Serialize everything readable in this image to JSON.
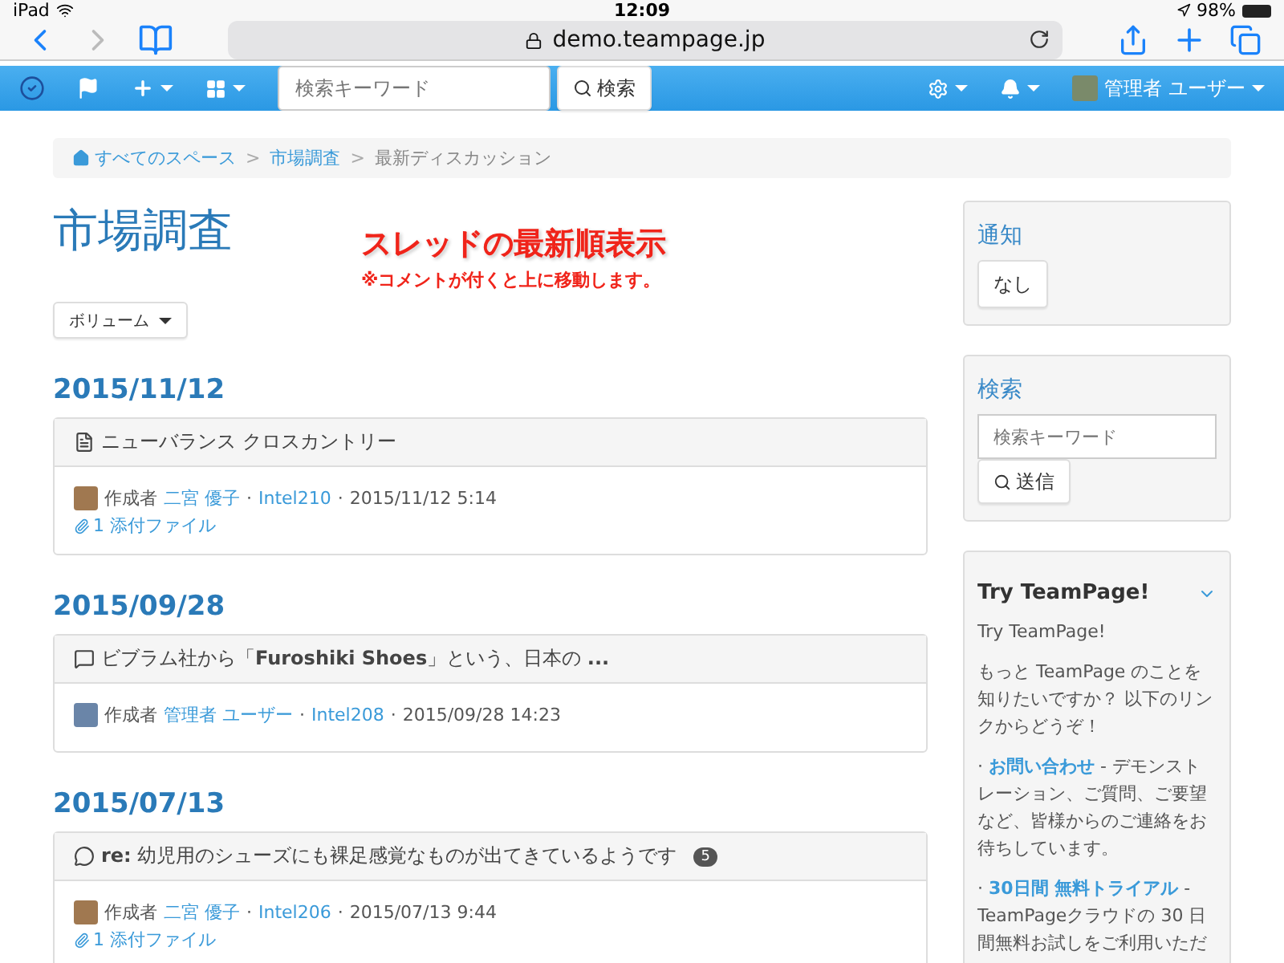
{
  "status_bar": {
    "device": "iPad",
    "time": "12:09",
    "battery": "98%"
  },
  "browser": {
    "url": "demo.teampage.jp"
  },
  "navbar": {
    "search_placeholder": "検索キーワード",
    "search_button": "検索",
    "user": "管理者 ユーザー"
  },
  "breadcrumb": [
    {
      "label": "すべてのスペース",
      "kind": "home"
    },
    {
      "separator": ">",
      "label": "市場調査",
      "kind": "link"
    },
    {
      "separator": ">",
      "label": "最新ディスカッション",
      "kind": "current"
    }
  ],
  "page_title": "市場調査",
  "volume_button": "ボリューム",
  "annotation": {
    "title": "スレッドの最新順表示",
    "note": "※コメントが付くと上に移動します。"
  },
  "posts": [
    {
      "date": "2015/11/12",
      "kind": "document",
      "title": "ニューバランス クロスカントリー",
      "author_label": "作成者",
      "author": "二宮 優子",
      "separators": [
        "·",
        "·"
      ],
      "space": "Intel210",
      "time": "2015/11/12 5:14",
      "attachment": "1 添付ファイル"
    },
    {
      "date": "2015/09/28",
      "kind": "comment",
      "title": "ビブラム社から「**Furoshiki Shoes**」という、日本の **...**",
      "author_label": "作成者",
      "author": "管理者 ユーザー",
      "separators": [
        "·",
        "·"
      ],
      "space": "Intel208",
      "time": "2015/09/28 14:23"
    },
    {
      "date": "2015/07/13",
      "kind": "reply",
      "title": "**re:** 幼児用のシューズにも裸足感覚なものが出てきているようです",
      "count": "5",
      "author_label": "作成者",
      "author": "二宮 優子",
      "separators": [
        "·",
        "·"
      ],
      "space": "Intel206",
      "time": "2015/07/13 9:44",
      "attachment": "1 添付ファイル"
    }
  ],
  "sidebar": {
    "notifications": {
      "title": "通知",
      "button": "なし"
    },
    "search": {
      "title": "検索",
      "placeholder": "検索キーワード",
      "button": "送信"
    },
    "try": {
      "title": "Try TeamPage!",
      "subtitle": "Try TeamPage!",
      "intro": "もっと TeamPage のことを知りたいですか？ 以下のリンクからどうぞ！",
      "items": [
        {
          "bullet": "·",
          "link": "お問い合わせ",
          "text": " - デモンストレーション、ご質問、ご要望など、皆様からのご連絡をお待ちしています。"
        },
        {
          "bullet": "·",
          "link": "30日間 無料トライアル",
          "text": " - TeamPageクラウドの 30 日間無料お試しをご利用いただ"
        }
      ]
    }
  }
}
